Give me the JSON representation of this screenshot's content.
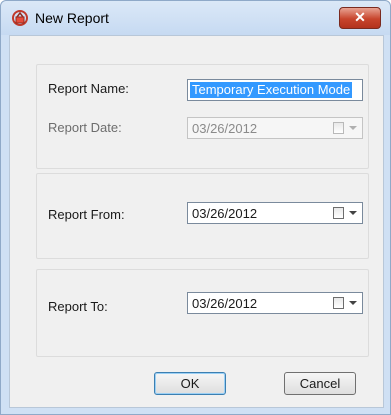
{
  "window": {
    "title": "New Report",
    "close_label": "✕"
  },
  "group_info": {
    "report_name_label": "Report Name:",
    "report_name_value": "Temporary Execution Mode",
    "report_date_label": "Report Date:",
    "report_date_value": "03/26/2012"
  },
  "group_from": {
    "label": "Report From:",
    "value": "03/26/2012"
  },
  "group_to": {
    "label": "Report To:",
    "value": "03/26/2012"
  },
  "buttons": {
    "ok": "OK",
    "cancel": "Cancel"
  },
  "colors": {
    "close_button": "#c7442c",
    "selection": "#3399ff",
    "titlebar": "#c6daf2"
  }
}
